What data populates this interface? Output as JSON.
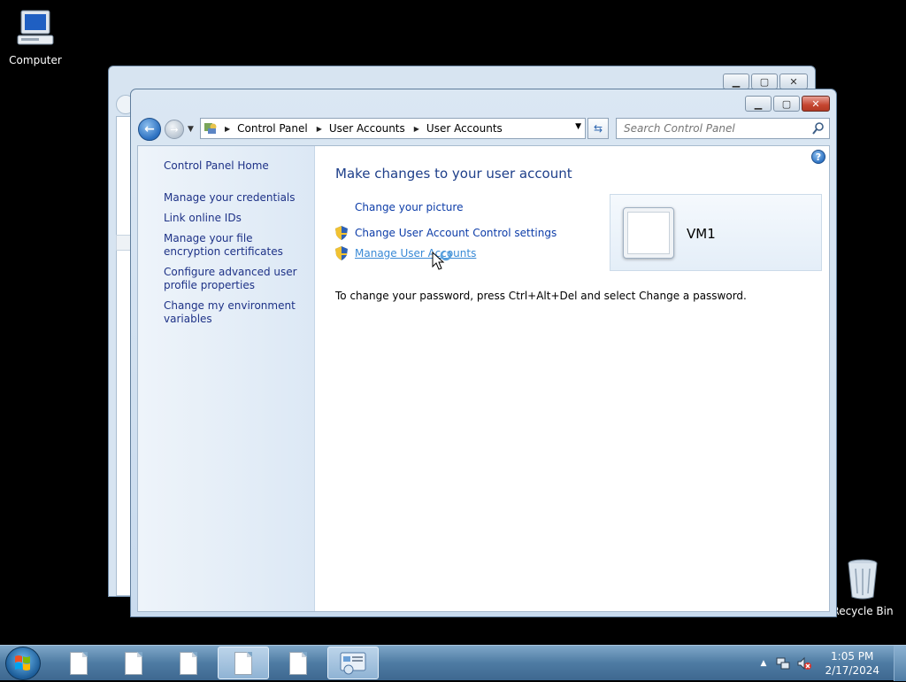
{
  "desktop": {
    "icons": [
      {
        "label": "Computer",
        "icon": "computer-icon"
      },
      {
        "label": "Recycle Bin",
        "icon": "recycle-bin-icon"
      }
    ]
  },
  "window": {
    "breadcrumb": [
      "Control Panel",
      "User Accounts",
      "User Accounts"
    ],
    "search_placeholder": "Search Control Panel",
    "sidebar": {
      "home": "Control Panel Home",
      "links": [
        "Manage your credentials",
        "Link online IDs",
        "Manage your file encryption certificates",
        "Configure advanced user profile properties",
        "Change my environment variables"
      ]
    },
    "main": {
      "heading": "Make changes to your user account",
      "tasks": [
        {
          "label": "Change your picture",
          "shield": false
        },
        {
          "label": "Change User Account Control settings",
          "shield": true
        },
        {
          "label": "Manage User Accounts",
          "shield": true
        }
      ],
      "note": "To change your password, press Ctrl+Alt+Del and select Change a password.",
      "user_name": "VM1"
    }
  },
  "taskbar": {
    "time": "1:05 PM",
    "date": "2/17/2024"
  },
  "colors": {
    "link": "#0c3ca8",
    "heading": "#1e3f8a",
    "sidebar_link": "#1e3287",
    "close_button": "#c54530"
  }
}
